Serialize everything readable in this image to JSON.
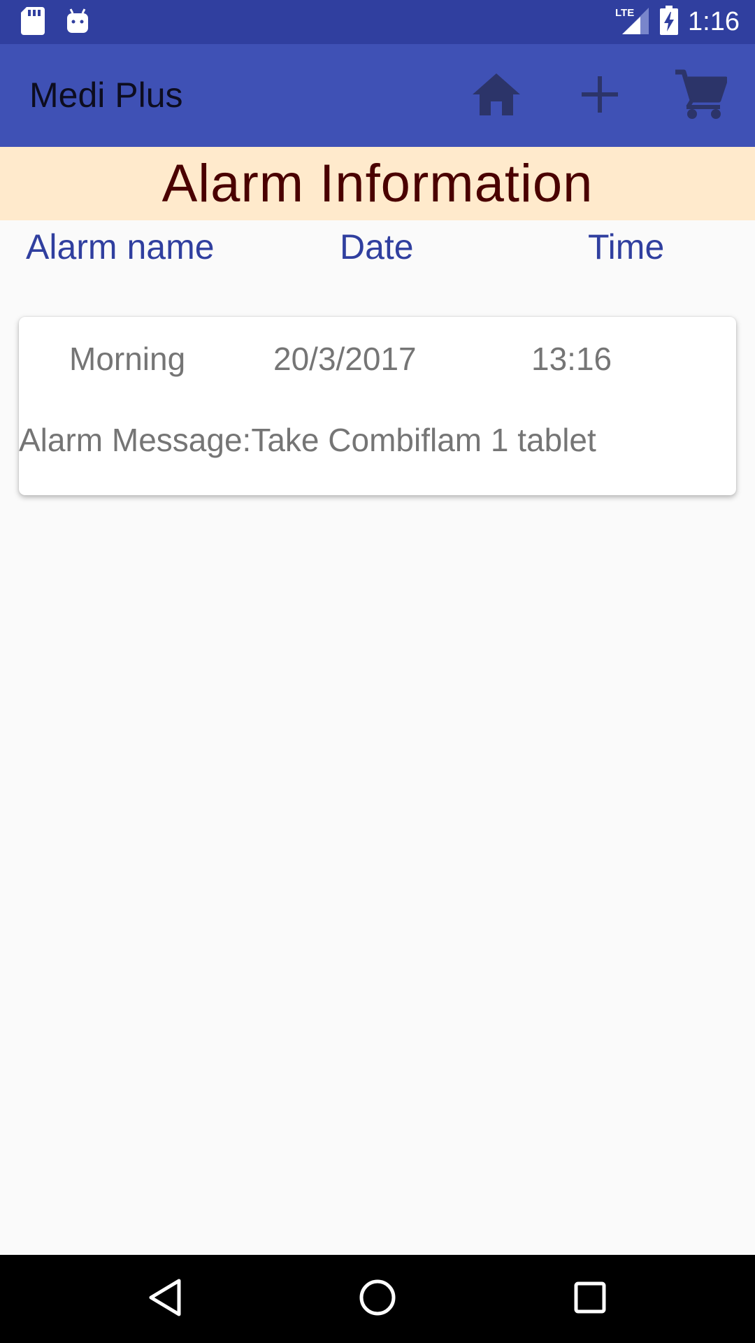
{
  "status_bar": {
    "time": "1:16",
    "network": "LTE",
    "icons": [
      "sd-card-icon",
      "android-icon",
      "signal-icon",
      "battery-charging-icon"
    ]
  },
  "app_bar": {
    "title": "Medi Plus",
    "actions": [
      "home-icon",
      "add-icon",
      "cart-icon"
    ]
  },
  "banner": {
    "title": "Alarm Information"
  },
  "columns": {
    "name": "Alarm name",
    "date": "Date",
    "time": "Time"
  },
  "alarms": [
    {
      "name": "Morning",
      "date": "20/3/2017",
      "time": "13:16",
      "message": "Alarm Message:Take Combiflam 1 tablet"
    }
  ],
  "nav_bar": {
    "buttons": [
      "back-icon",
      "home-circle-icon",
      "recents-icon"
    ]
  },
  "colors": {
    "status_bar": "#303f9f",
    "app_bar": "#3f51b5",
    "banner_bg": "#ffeacc",
    "banner_text": "#4a0000",
    "column_header": "#303f9f",
    "card_text": "#757575"
  }
}
